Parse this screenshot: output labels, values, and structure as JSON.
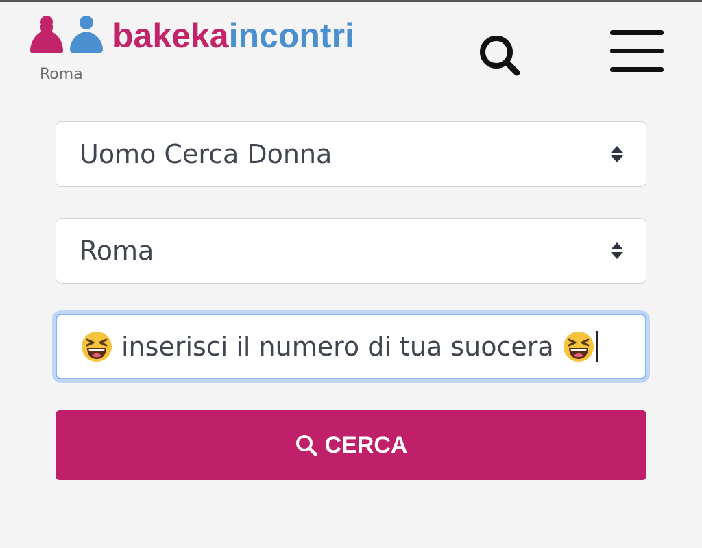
{
  "header": {
    "brand_part1": "bakeka",
    "brand_part2": "incontri",
    "city": "Roma",
    "brand_colors": {
      "pink": "#c2246a",
      "blue": "#4a90d0"
    },
    "icons": [
      "search-icon",
      "menu-icon"
    ]
  },
  "form": {
    "category_select": {
      "value": "Uomo Cerca Donna"
    },
    "city_select": {
      "value": "Roma"
    },
    "search_input": {
      "emoji_left": "😆",
      "text": "inserisci il numero di tua suocera",
      "emoji_right": "😆"
    },
    "submit": {
      "label": "CERCA",
      "color": "#c0206a"
    }
  }
}
